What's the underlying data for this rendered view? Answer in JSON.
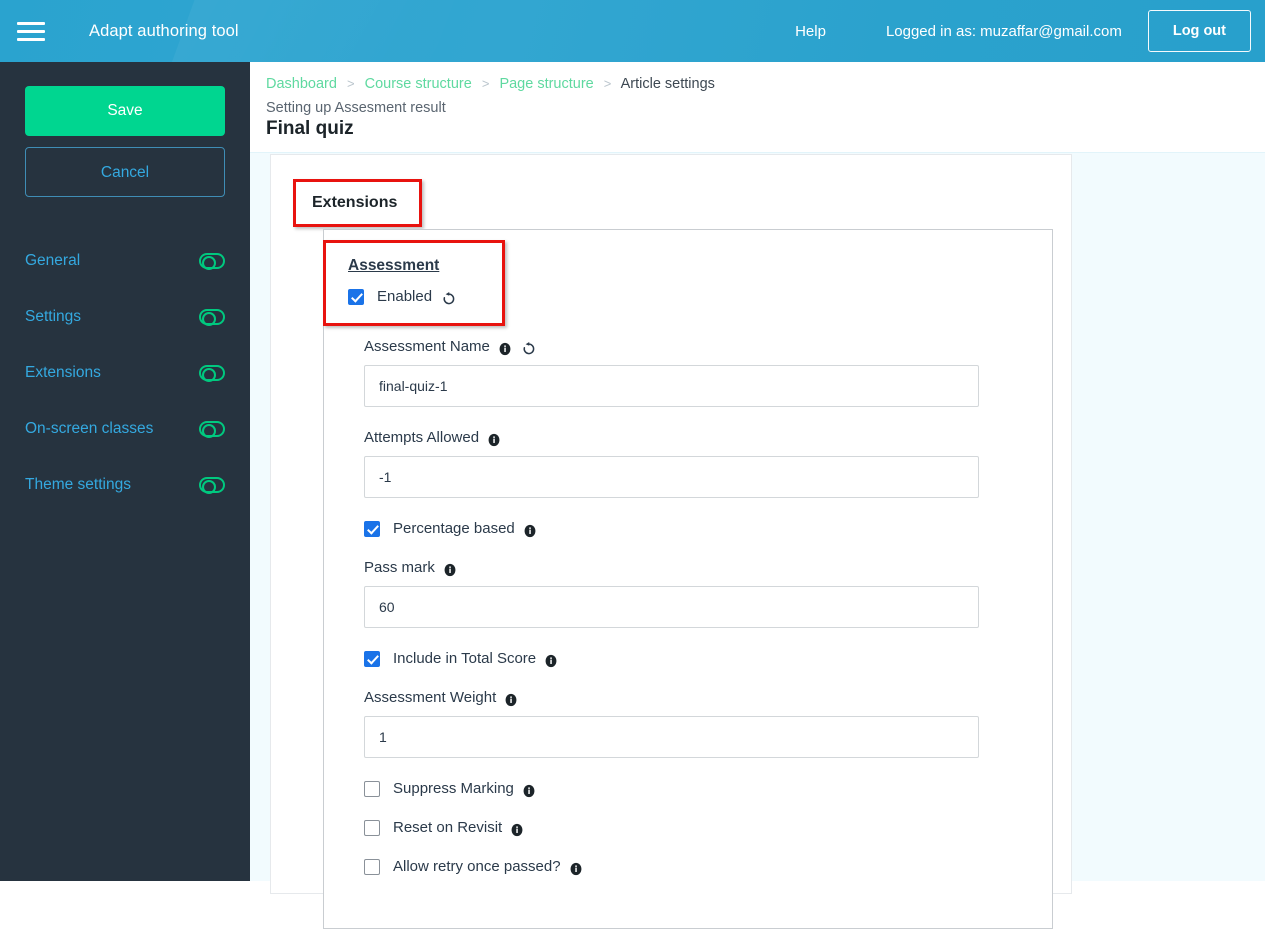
{
  "header": {
    "menu_icon": "hamburger-icon",
    "brand": "Adapt authoring tool",
    "help_label": "Help",
    "logged_in_text": "Logged in as: muzaffar@gmail.com",
    "logout_label": "Log out",
    "background_color": "#2ba2cd"
  },
  "sidebar": {
    "save_label": "Save",
    "cancel_label": "Cancel",
    "save_color": "#00d690",
    "link_color": "#34a9e0",
    "toggle_color": "#00c97f",
    "background_color": "#26333f",
    "items": [
      {
        "label": "General",
        "toggle": "toggle-icon"
      },
      {
        "label": "Settings",
        "toggle": "toggle-icon"
      },
      {
        "label": "Extensions",
        "toggle": "toggle-icon"
      },
      {
        "label": "On-screen classes",
        "toggle": "toggle-icon"
      },
      {
        "label": "Theme settings",
        "toggle": "toggle-icon"
      }
    ]
  },
  "breadcrumb": {
    "items": [
      "Dashboard",
      "Course structure",
      "Page structure"
    ],
    "current": "Article settings",
    "separator": ">",
    "link_color": "#5fd9a0"
  },
  "page": {
    "subtitle": "Setting up Assesment result",
    "title": "Final quiz"
  },
  "main": {
    "section_heading": "Extensions",
    "highlight_color": "#e8130f",
    "assessment": {
      "title": "Assessment",
      "enabled_label": "Enabled",
      "enabled_checked": true,
      "reset_icon": "reset-icon"
    },
    "fields": [
      {
        "type": "text",
        "label": "Assessment Name",
        "value": "final-quiz-1",
        "info_icon": "info-icon",
        "has_reset": true,
        "reset_icon": "reset-icon"
      },
      {
        "type": "text",
        "label": "Attempts Allowed",
        "value": "-1",
        "info_icon": "info-icon",
        "has_reset": false
      },
      {
        "type": "checkbox",
        "label": "Percentage based",
        "checked": true,
        "info_icon": "info-icon"
      },
      {
        "type": "text",
        "label": "Pass mark",
        "value": "60",
        "info_icon": "info-icon",
        "has_reset": false
      },
      {
        "type": "checkbox",
        "label": "Include in Total Score",
        "checked": true,
        "info_icon": "info-icon"
      },
      {
        "type": "text",
        "label": "Assessment Weight",
        "value": "1",
        "info_icon": "info-icon",
        "has_reset": false
      },
      {
        "type": "checkbox",
        "label": "Suppress Marking",
        "checked": false,
        "info_icon": "info-icon"
      },
      {
        "type": "checkbox",
        "label": "Reset on Revisit",
        "checked": false,
        "info_icon": "info-icon"
      },
      {
        "type": "checkbox",
        "label": "Allow retry once passed?",
        "checked": false,
        "info_icon": "info-icon"
      }
    ]
  }
}
